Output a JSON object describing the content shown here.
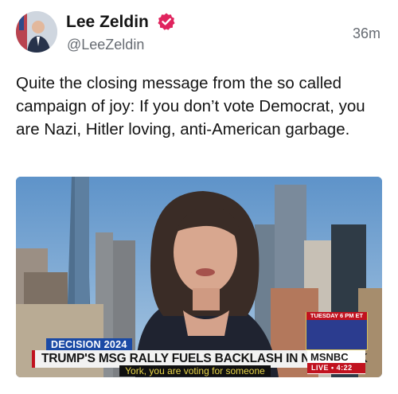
{
  "post": {
    "author_name": "Lee Zeldin",
    "handle": "@LeeZeldin",
    "timestamp": "36m",
    "text": "Quite the closing message from the so called campaign of joy: If you don’t vote Democrat, you are Nazi, Hitler loving, anti-American garbage."
  },
  "media": {
    "caption": "York, you are voting for someone",
    "headline": "TRUMP'S MSG RALLY FUELS BACKLASH IN NEW YORK",
    "decision_tag": "DECISION 2024",
    "network": "MSNBC",
    "live_label": "LIVE • 4:22",
    "promo_date": "TUESDAY 6 PM ET"
  },
  "colors": {
    "verified_badge": "#e0245e",
    "ticker_red": "#c1121f",
    "caption_text": "#e9d548"
  }
}
